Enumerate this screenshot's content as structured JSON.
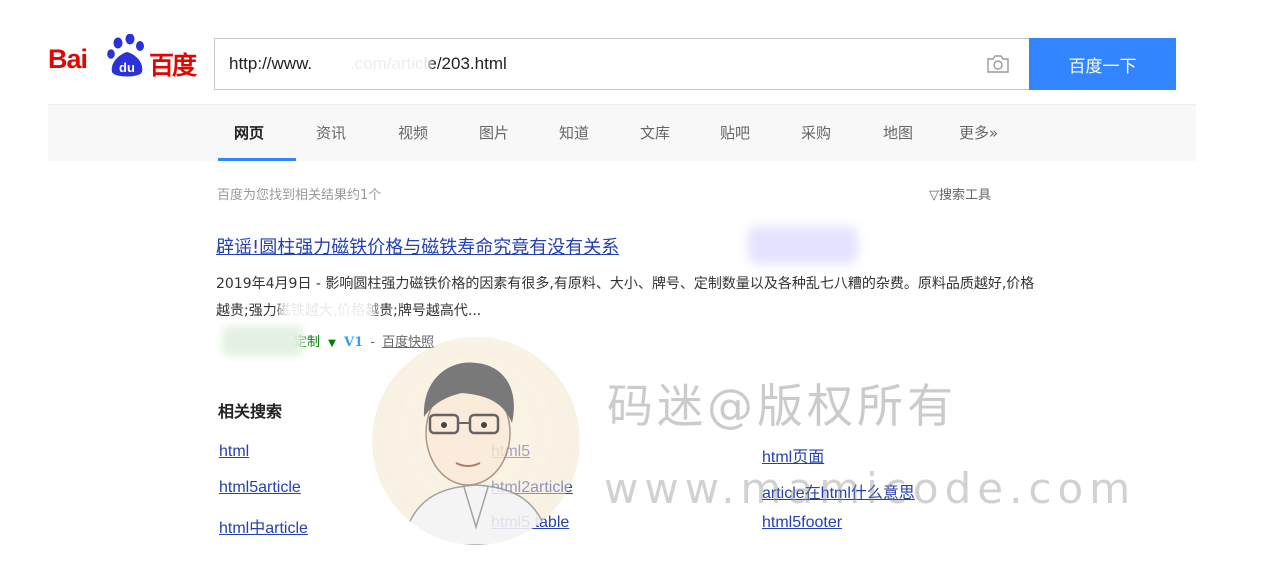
{
  "logo": {
    "text_bai": "Bai",
    "text_cn": "百度",
    "paw_label": "du"
  },
  "search": {
    "value": "http://www.        .com/article/203.html",
    "button_label": "百度一下",
    "camera_icon": "camera-icon"
  },
  "tabs": [
    {
      "label": "网页",
      "active": true
    },
    {
      "label": "资讯"
    },
    {
      "label": "视频"
    },
    {
      "label": "图片"
    },
    {
      "label": "知道"
    },
    {
      "label": "文库"
    },
    {
      "label": "贴吧"
    },
    {
      "label": "采购"
    },
    {
      "label": "地图"
    },
    {
      "label": "更多»"
    }
  ],
  "results_info": {
    "count_text": "百度为您找到相关结果约1个",
    "tools_label": "▽搜索工具"
  },
  "result": {
    "title": "辟谣!圆柱强力磁铁价格与磁铁寿命究竟有没有关系",
    "abstract": "2019年4月9日 - 影响圆柱强力磁铁价格的因素有很多,有原料、大小、牌号、定制数量以及各种乱七八糟的杂费。原料品质越好,价格越贵;强力磁铁越大,价格越贵;牌号越高代...",
    "source": "定制",
    "v1": "V1",
    "separator": "-",
    "snapshot": "百度快照"
  },
  "related": {
    "heading": "相关搜索",
    "links": [
      "html",
      "html5",
      "html页面",
      "html5article",
      "html2article",
      "article在html什么意思",
      "html中article",
      "html5 table",
      "html5footer"
    ]
  },
  "watermark": {
    "line1": "码迷@版权所有",
    "line2": "www.mamicode.com"
  },
  "colors": {
    "accent": "#3385ff",
    "link": "#2440b3",
    "brand_red": "#e10602",
    "source_green": "#008000"
  }
}
